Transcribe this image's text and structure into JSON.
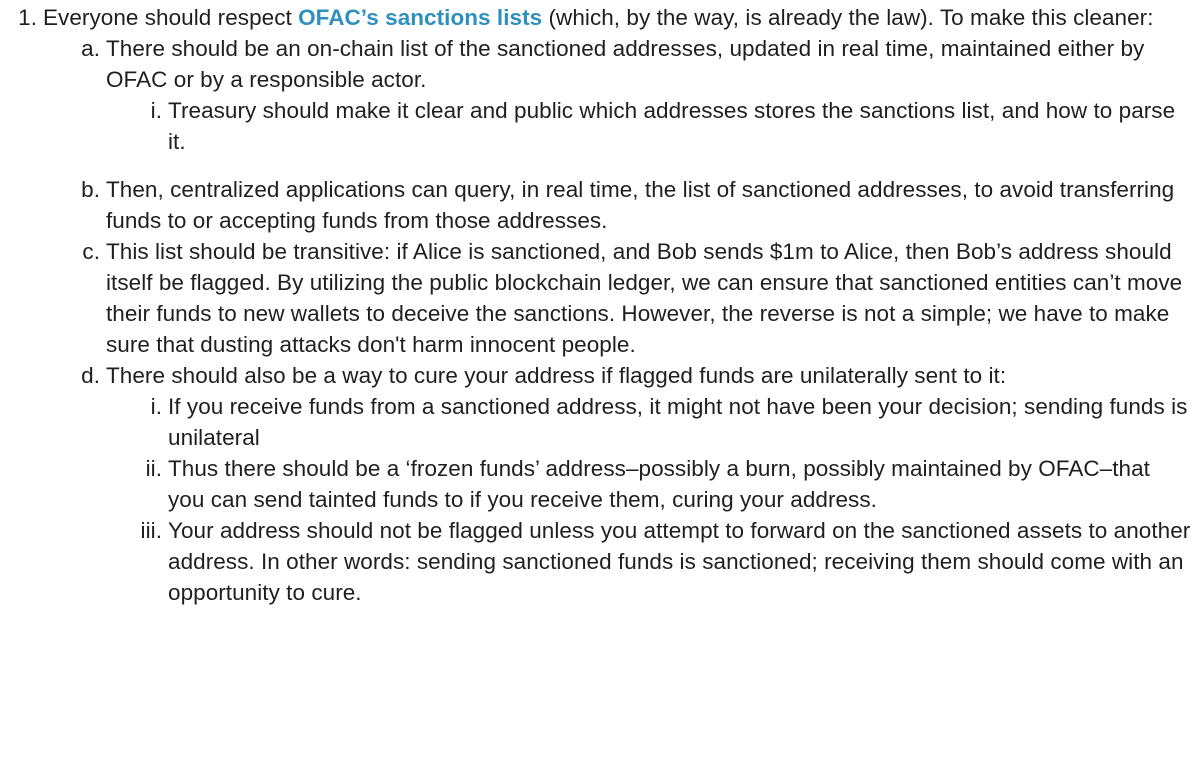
{
  "item1": {
    "marker": "1.",
    "text_before": "Everyone should respect ",
    "link_text": "OFAC’s sanctions lists",
    "text_after": " (which, by the way, is already the law). To make this cleaner:"
  },
  "item_a": {
    "marker": "a.",
    "text": "There should be an on-chain list of the sanctioned addresses, updated in real time, maintained either by OFAC or by a responsible actor.",
    "sub_i": {
      "marker": "i.",
      "text": "Treasury should make it clear and public which addresses stores the sanctions list, and how to parse it."
    }
  },
  "item_b": {
    "marker": "b.",
    "text": "Then, centralized applications can query, in real time, the list of sanctioned addresses, to avoid transferring funds to or accepting funds from those addresses."
  },
  "item_c": {
    "marker": "c.",
    "text": "This list should be transitive: if Alice is sanctioned, and Bob sends $1m to Alice, then Bob’s address should itself be flagged. By utilizing the public blockchain ledger, we can ensure that sanctioned entities can’t move their funds to new wallets to deceive the sanctions. However, the reverse is not a simple; we have to make sure that dusting attacks don't harm innocent people."
  },
  "item_d": {
    "marker": "d.",
    "text": "There should also be a way to cure your address if flagged funds are unilaterally sent to it:",
    "sub_i": {
      "marker": "i.",
      "text": "If you receive funds from a sanctioned address, it might not have been your decision; sending funds is unilateral"
    },
    "sub_ii": {
      "marker": "ii.",
      "text": "Thus there should be a ‘frozen funds’ address–possibly a burn, possibly maintained by OFAC–that you can send tainted funds to if you receive them, curing your address."
    },
    "sub_iii": {
      "marker": "iii.",
      "text": "Your address should not be flagged unless you attempt to forward on the sanctioned assets to another address. In other words: sending sanctioned funds is sanctioned; receiving them should come with an opportunity to cure."
    }
  },
  "colors": {
    "text": "#1f1f1f",
    "link": "#2f8fbf",
    "background": "#ffffff"
  }
}
